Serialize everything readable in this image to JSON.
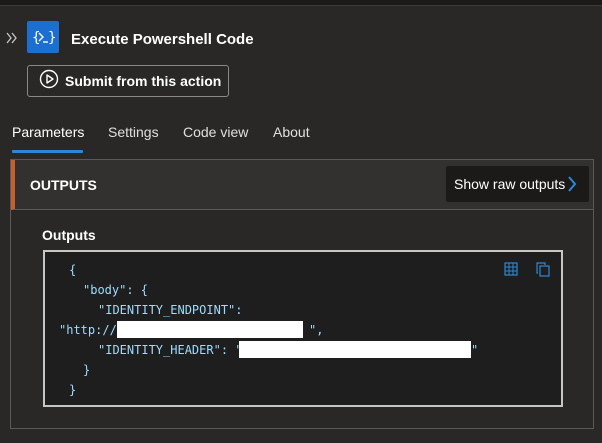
{
  "action": {
    "title": "Execute Powershell Code",
    "icon": "powershell-icon",
    "icon_color": "#1a6fd1",
    "submit_label": "Submit from this action"
  },
  "tabs": [
    {
      "label": "Parameters",
      "active": true
    },
    {
      "label": "Settings",
      "active": false
    },
    {
      "label": "Code view",
      "active": false
    },
    {
      "label": "About",
      "active": false
    }
  ],
  "outputs_section": {
    "title": "OUTPUTS",
    "raw_button_label": "Show raw outputs",
    "accent_color": "#c85e2a",
    "outputs_label": "Outputs"
  },
  "code": {
    "open_brace": "{",
    "body_key": "\"body\": {",
    "identity_endpoint_key": "\"IDENTITY_ENDPOINT\":",
    "identity_endpoint_value_prefix": "\"http://",
    "identity_endpoint_value_suffix": "\",",
    "identity_header_key": "\"IDENTITY_HEADER\": \"",
    "identity_header_suffix": "\"",
    "inner_close": "}",
    "outer_close": "}"
  },
  "colors": {
    "background": "#292827",
    "tab_underline": "#2b88d8",
    "code_text": "#9cdcfe"
  }
}
